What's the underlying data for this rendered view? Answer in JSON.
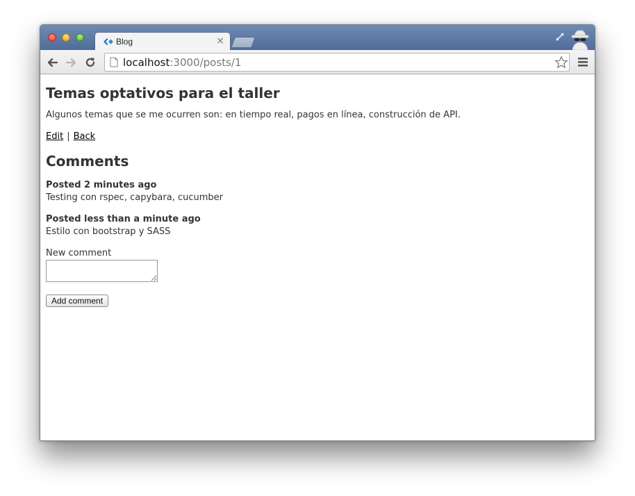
{
  "browser": {
    "tab": {
      "title": "Blog",
      "close": "×"
    },
    "address": {
      "host": "localhost",
      "path": ":3000/posts/1"
    }
  },
  "post": {
    "title": "Temas optativos para el taller",
    "body": "Algunos temas que se me ocurren son: en tiempo real, pagos en línea, construcción de API.",
    "edit_label": "Edit",
    "separator": "|",
    "back_label": "Back"
  },
  "comments_section": {
    "heading": "Comments",
    "items": [
      {
        "meta": "Posted 2 minutes ago",
        "text": "Testing con rspec, capybara, cucumber"
      },
      {
        "meta": "Posted less than a minute ago",
        "text": "Estilo con bootstrap y SASS"
      }
    ]
  },
  "form": {
    "label": "New comment",
    "value": "",
    "submit_label": "Add comment"
  },
  "colors": {
    "titlebar": "#5b78a4",
    "text": "#333333"
  }
}
